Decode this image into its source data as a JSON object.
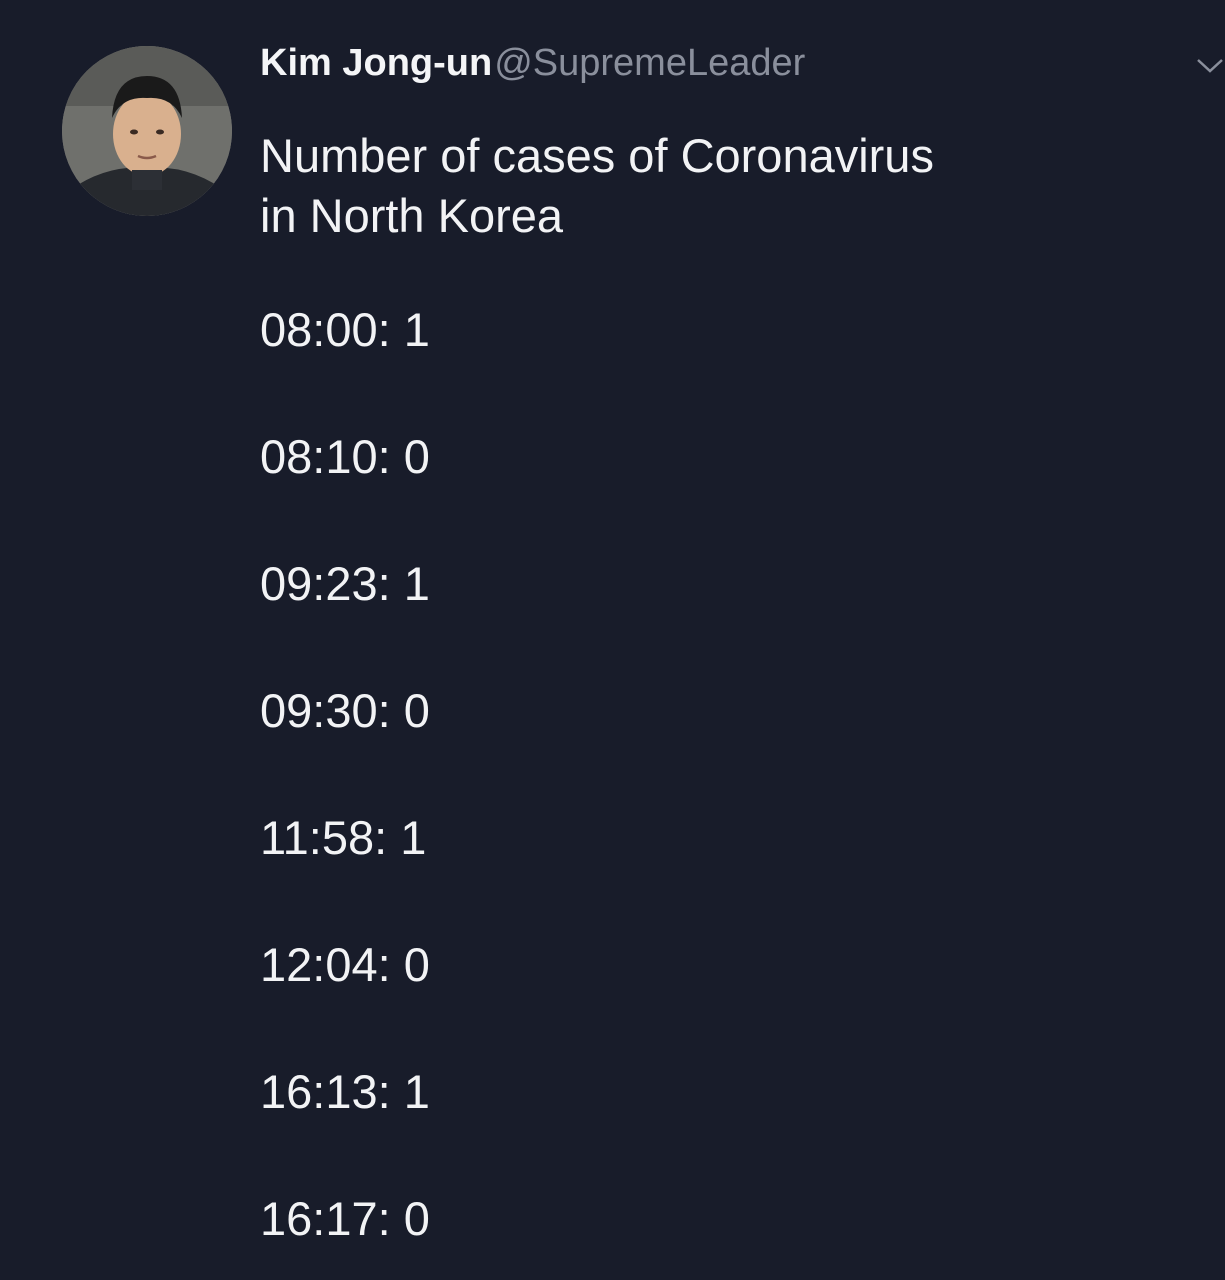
{
  "tweet": {
    "author": {
      "display_name": "Kim Jong-un",
      "handle": "@SupremeLeader"
    },
    "text_line_1": "Number of cases of Coronavirus",
    "text_line_2": "in North Korea",
    "entries": [
      "08:00: 1",
      "08:10: 0",
      "09:23: 1",
      "09:30: 0",
      "11:58: 1",
      "12:04: 0",
      "16:13: 1",
      "16:17: 0"
    ],
    "menu_icon": "chevron-down-icon"
  },
  "colors": {
    "background": "#181c2a",
    "text": "#f2f3f5",
    "handle": "#8a8f9c"
  }
}
